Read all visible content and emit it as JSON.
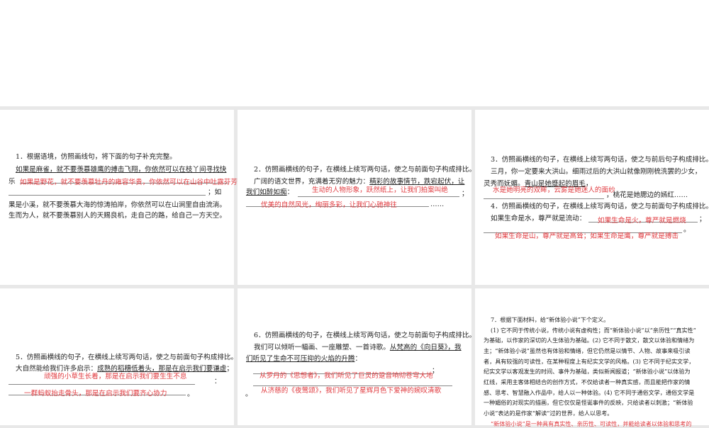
{
  "q1": {
    "title": "1．根据语境，仿照画线句，将下面的句子补充完整。",
    "underlined": "如果是麻雀，就不要羡慕雄鹰的搏击飞翔，你依然可以在枝丫间寻找快",
    "cont": "乐",
    "answer": "如果是野花，就不要羡慕牡丹的雍容华贵，你依然可以在山谷中吐露芬芳",
    "after_blank": "；如",
    "line3": "果是小溪，就不要羡慕大海的惊涛拍岸，你依然可以在山涧里自由流淌。",
    "line4": "生而为人，就不要羡慕别人的天赐良机，走自己的路，给自己一方天空。"
  },
  "q2": {
    "title": "2．仿照画横线的句子，在横线上续写两句话，使之与前面句子构成排比。",
    "lead": "广阔的语文世界，充满着无穷的魅力：",
    "underlined1": "精彩的故事情节，跌宕起伏，让",
    "underlined2": "我们如醉如痴",
    "colon": "：",
    "answer1": "生动的人物形象，跃然纸上，让我们拍案叫绝",
    "semi": "；",
    "answer2": "优美的自然风光，绚丽多彩，让我们心驰神往",
    "ellipsis": "……"
  },
  "q3": {
    "title": "3．仿照画横线的句子，在横线上续写两句话，使之与前后句子构成排比。",
    "line1": "三月，你一定要来大洪山。细雨过后的大洪山就像刚刚梳洗罢的少女，",
    "line2a": "灵秀而妩媚。",
    "underlined": "青山是她蹙起的眉毛",
    "comma": "，",
    "answer": "水是她明亮的双眸，云雾是她迷人的面纱",
    "after": "，桃花是她腮边的嫣红……"
  },
  "q4": {
    "title": "4．仿照画横线的句子，在横线上续写两句话，使之与前面句子构成排比。",
    "lead": "如果生命是水，尊严就是流动：",
    "answer1": "如果生命是火，尊严就是燃烧",
    "semi": "；",
    "period": "。",
    "answer2": "如果生命是山，尊严就是高耸；如果生命是鹰，尊严就是搏击"
  },
  "q5": {
    "title": "5．仿照画横线的句子，在横线上续写两句话，使之与前面句子构成排比。",
    "lead": "大自然能给我们许多启示：",
    "underlined": "成熟的稻穗低着头，那是在启示我们要谦虚",
    "semi": "；",
    "answer1": "顽强的小草生长着，那是在启示我们要生生不息",
    "colon": "：",
    "answer2": "一群蚂蚁抬走骨头，那是在启示我们要齐心协力",
    "period": "。"
  },
  "q6": {
    "title": "6．仿照画横线的句子，在横线上续写两句话，使之与前面句子构成排比。",
    "lead": "我们可以倾听一幅画、一座雕塑、一首诗歌。",
    "underlined1": "从梵高的《向日葵》，我",
    "underlined2": "们听见了生命不可压抑的火焰的升腾",
    "colon": "：",
    "semi": "；",
    "answer1": "从罗丹的《思想者》，我们听见了巨灵的跫音响彻苍穹大地",
    "answer2": "从济慈的《夜莺颂》，我们听见了星辉月色下爱神的婉叹清歌",
    "period": "。"
  },
  "q7": {
    "title": "7．根据下面材料，给“新体验小说”下个定义。",
    "lines": [
      "(1) 它不同于传统小说，传统小说有虚构性；而“新体验小说”以“亲历性”“真实性”",
      "为基础，以作家的深切的人生体验为基础。(2) 它不同于散文，散文以体验和情绪为",
      "主；“新体验小说”虽然也有体验和情绪，但它仍然是以情节、人物、故事来吸引读",
      "者，具有较强的可读性，在某种程度上有纪实文学的风格。(3) 它不同于纪实文学，",
      "纪实文学以客观发生的时间、事件为基础，类似新闻报道；“新体验小说”以体验为",
      "红线，采用主客体相结合的创作方式，不仅给读者一种真实感，而且能把作家的情",
      "感、思考、智慧融入作品中，给人以一种体验。(4) 它不同于通俗文学，通俗文学是",
      "一种媚俗的对现实的描画，但它仅仅是怪诞事件的反映，只给读者以刺激；“新体验",
      "小说”表达的是作家“解读”过的世界，给人以思考。"
    ],
    "answer": "“新体验小说”是一种具有真实性、亲历性、可读性，并能给读者以体验和思考的"
  }
}
